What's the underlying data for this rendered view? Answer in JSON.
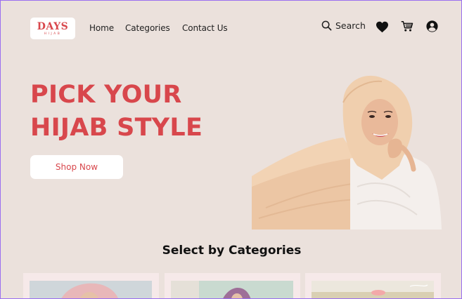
{
  "brand": {
    "name": "DAYS",
    "tagline": "HIJAB"
  },
  "nav": {
    "links": [
      "Home",
      "Categories",
      "Contact Us"
    ]
  },
  "header": {
    "search_label": "Search",
    "icons": [
      "search-icon",
      "heart-icon",
      "cart-icon",
      "account-icon"
    ]
  },
  "hero": {
    "title_line1": "PICK YOUR",
    "title_line2": "HIJAB STYLE",
    "cta_label": "Shop Now",
    "image": "hero-model-photo"
  },
  "categories": {
    "title": "Select by Categories",
    "card_images": [
      "category-photo-1",
      "category-photo-2",
      "category-photo-3"
    ]
  },
  "colors": {
    "background": "#ebe1dc",
    "accent": "#d8474c",
    "card": "#f6e9e9",
    "button": "#ffffff",
    "frame_border": "#9a6ff0"
  }
}
